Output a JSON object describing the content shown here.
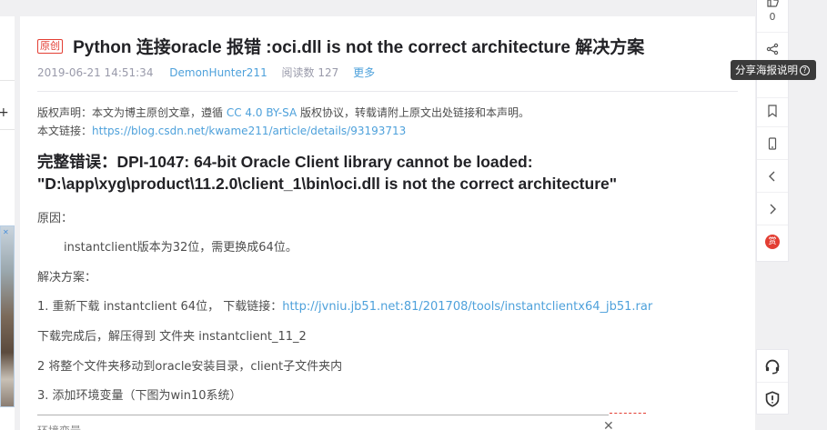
{
  "article": {
    "badge": "原创",
    "title": "Python 连接oracle 报错 :oci.dll is not the correct architecture 解决方案",
    "date": "2019-06-21 14:51:34",
    "author": "DemonHunter211",
    "read_count": "阅读数 127",
    "more": "更多",
    "copyright_prefix": "版权声明：本文为博主原创文章，遵循",
    "license": "CC 4.0 BY-SA",
    "copyright_suffix": "版权协议，转载请附上原文出处链接和本声明。",
    "link_label": "本文链接：",
    "link_url": "https://blog.csdn.net/kwame211/article/details/93193713",
    "heading_line1": "完整错误：DPI-1047: 64-bit Oracle Client library cannot be loaded:",
    "heading_line2": "\"D:\\app\\xyg\\product\\11.2.0\\client_1\\bin\\oci.dll is not the correct architecture\"",
    "cause_label": "原因：",
    "cause_text": "instantclient版本为32位，需更换成64位。",
    "solution_label": "解决方案：",
    "step1_text": "1. 重新下载 instantclient 64位， 下载链接：",
    "step1_link": "http://jvniu.jb51.net:81/201708/tools/instantclientx64_jb51.rar",
    "step1b_text": "下载完成后，解压得到 文件夹 instantclient_11_2",
    "step2_text": "2   将整个文件夹移动到oracle安装目录，client子文件夹内",
    "step3_text": "3.  添加环境变量（下图为win10系统）",
    "subwindow_title": "环境变量",
    "subwindow_close": "✕"
  },
  "toolbar": {
    "like_count": "0",
    "share_tooltip": "分享海报说明",
    "tooltip_help": "?",
    "reward_label": "赏"
  },
  "left": {
    "plus": "+"
  },
  "ad": {
    "close": "✕"
  },
  "colors": {
    "accent": "#e33e33",
    "link": "#4ea1db"
  }
}
